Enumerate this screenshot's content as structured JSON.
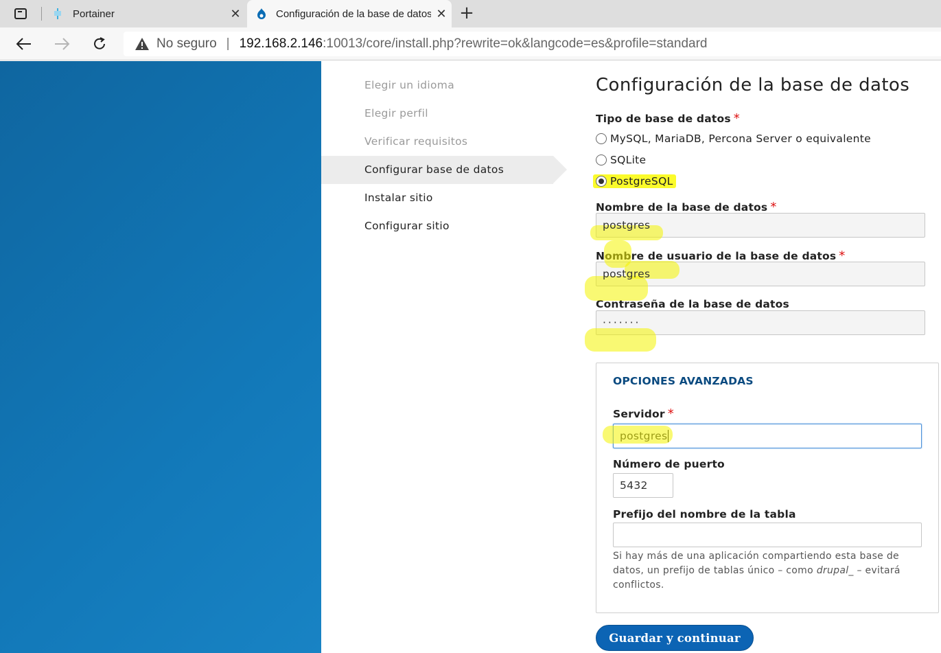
{
  "browser": {
    "tabs": [
      {
        "title": "Portainer",
        "active": false
      },
      {
        "title": "Configuración de la base de datos",
        "active": true
      }
    ],
    "new_tab_glyph": "+",
    "close_glyph": "✕",
    "address": {
      "security_label": "No seguro",
      "separator": "|",
      "host": "192.168.2.146",
      "rest": ":10013/core/install.php?rewrite=ok&langcode=es&profile=standard"
    }
  },
  "steps": [
    {
      "label": "Elegir un idioma",
      "state": "done"
    },
    {
      "label": "Elegir perfil",
      "state": "done"
    },
    {
      "label": "Verificar requisitos",
      "state": "done"
    },
    {
      "label": "Configurar base de datos",
      "state": "current"
    },
    {
      "label": "Instalar sitio",
      "state": "pending"
    },
    {
      "label": "Configurar sitio",
      "state": "pending"
    }
  ],
  "form": {
    "title": "Configuración de la base de datos",
    "db_type": {
      "label": "Tipo de base de datos",
      "required_mark": "*",
      "options": [
        {
          "label": "MySQL, MariaDB, Percona Server o equivalente",
          "checked": false
        },
        {
          "label": "SQLite",
          "checked": false
        },
        {
          "label": "PostgreSQL",
          "checked": true
        }
      ]
    },
    "db_name": {
      "label": "Nombre de la base de datos",
      "required_mark": "*",
      "value": "postgres"
    },
    "db_user": {
      "label": "Nombre de usuario de la base de datos",
      "required_mark": "*",
      "value": "postgres"
    },
    "db_pass": {
      "label": "Contraseña de la base de datos",
      "value": "·······"
    },
    "advanced": {
      "legend": "OPCIONES AVANZADAS",
      "host": {
        "label": "Servidor",
        "required_mark": "*",
        "value": "postgres"
      },
      "port": {
        "label": "Número de puerto",
        "value": "5432"
      },
      "prefix": {
        "label": "Prefijo del nombre de la tabla",
        "value": "",
        "desc_before": "Si hay más de una aplicación compartiendo esta base de datos, un prefijo de tablas único – como ",
        "desc_em": "drupal_",
        "desc_after": " – evitará conflictos."
      }
    },
    "submit_label": "Guardar y continuar"
  },
  "colors": {
    "side_panel": "#1278b8",
    "highlight": "#f4f400",
    "required": "#dd1111",
    "button": "#0c64b4"
  }
}
